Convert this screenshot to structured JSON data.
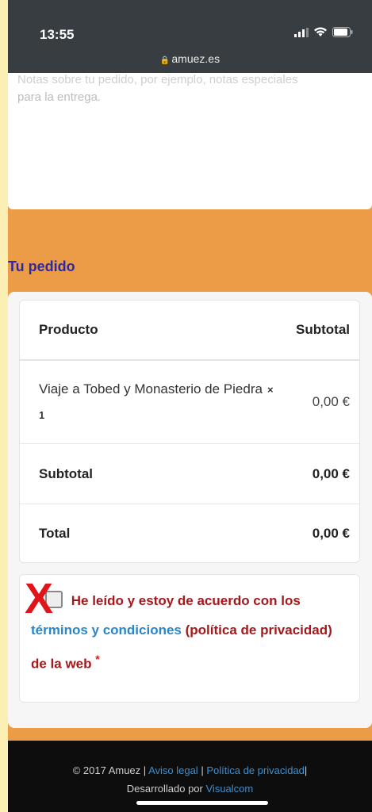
{
  "status_bar": {
    "time": "13:55",
    "url": "amuez.es",
    "icons": [
      "signal-icon",
      "wifi-icon",
      "battery-icon",
      "lock-icon"
    ]
  },
  "notes": {
    "placeholder_line1": "Notas sobre tu pedido, por ejemplo, notas especiales",
    "placeholder_line2": "para la entrega."
  },
  "order": {
    "title": "Tu pedido",
    "header": {
      "product": "Producto",
      "subtotal": "Subtotal"
    },
    "items": [
      {
        "name": "Viaje a Tobed y Monasterio de Piedra",
        "qty": "× 1",
        "price": "0,00 €"
      }
    ],
    "subtotal": {
      "label": "Subtotal",
      "value": "0,00 €"
    },
    "total": {
      "label": "Total",
      "value": "0,00 €"
    }
  },
  "terms": {
    "text_before": "He leído y estoy de acuerdo con los",
    "link": "términos y condiciones",
    "text_after": "(política de privacidad) de la web",
    "required": "*",
    "annotation": "X"
  },
  "footer": {
    "copyright": "© 2017 Amuez |",
    "link_legal": "Aviso legal",
    "sep": "|",
    "link_privacy": "Política de privacidad",
    "sep2": "|",
    "developed_by": "Desarrollado por",
    "link_dev": "Visualcom"
  },
  "colors": {
    "page_background": "#ec9b47",
    "title": "#2a2aa8",
    "terms_text": "#a3191c",
    "link": "#2a86c8",
    "annotation_x": "#e0141b",
    "outer_border": "#fcefb4"
  }
}
